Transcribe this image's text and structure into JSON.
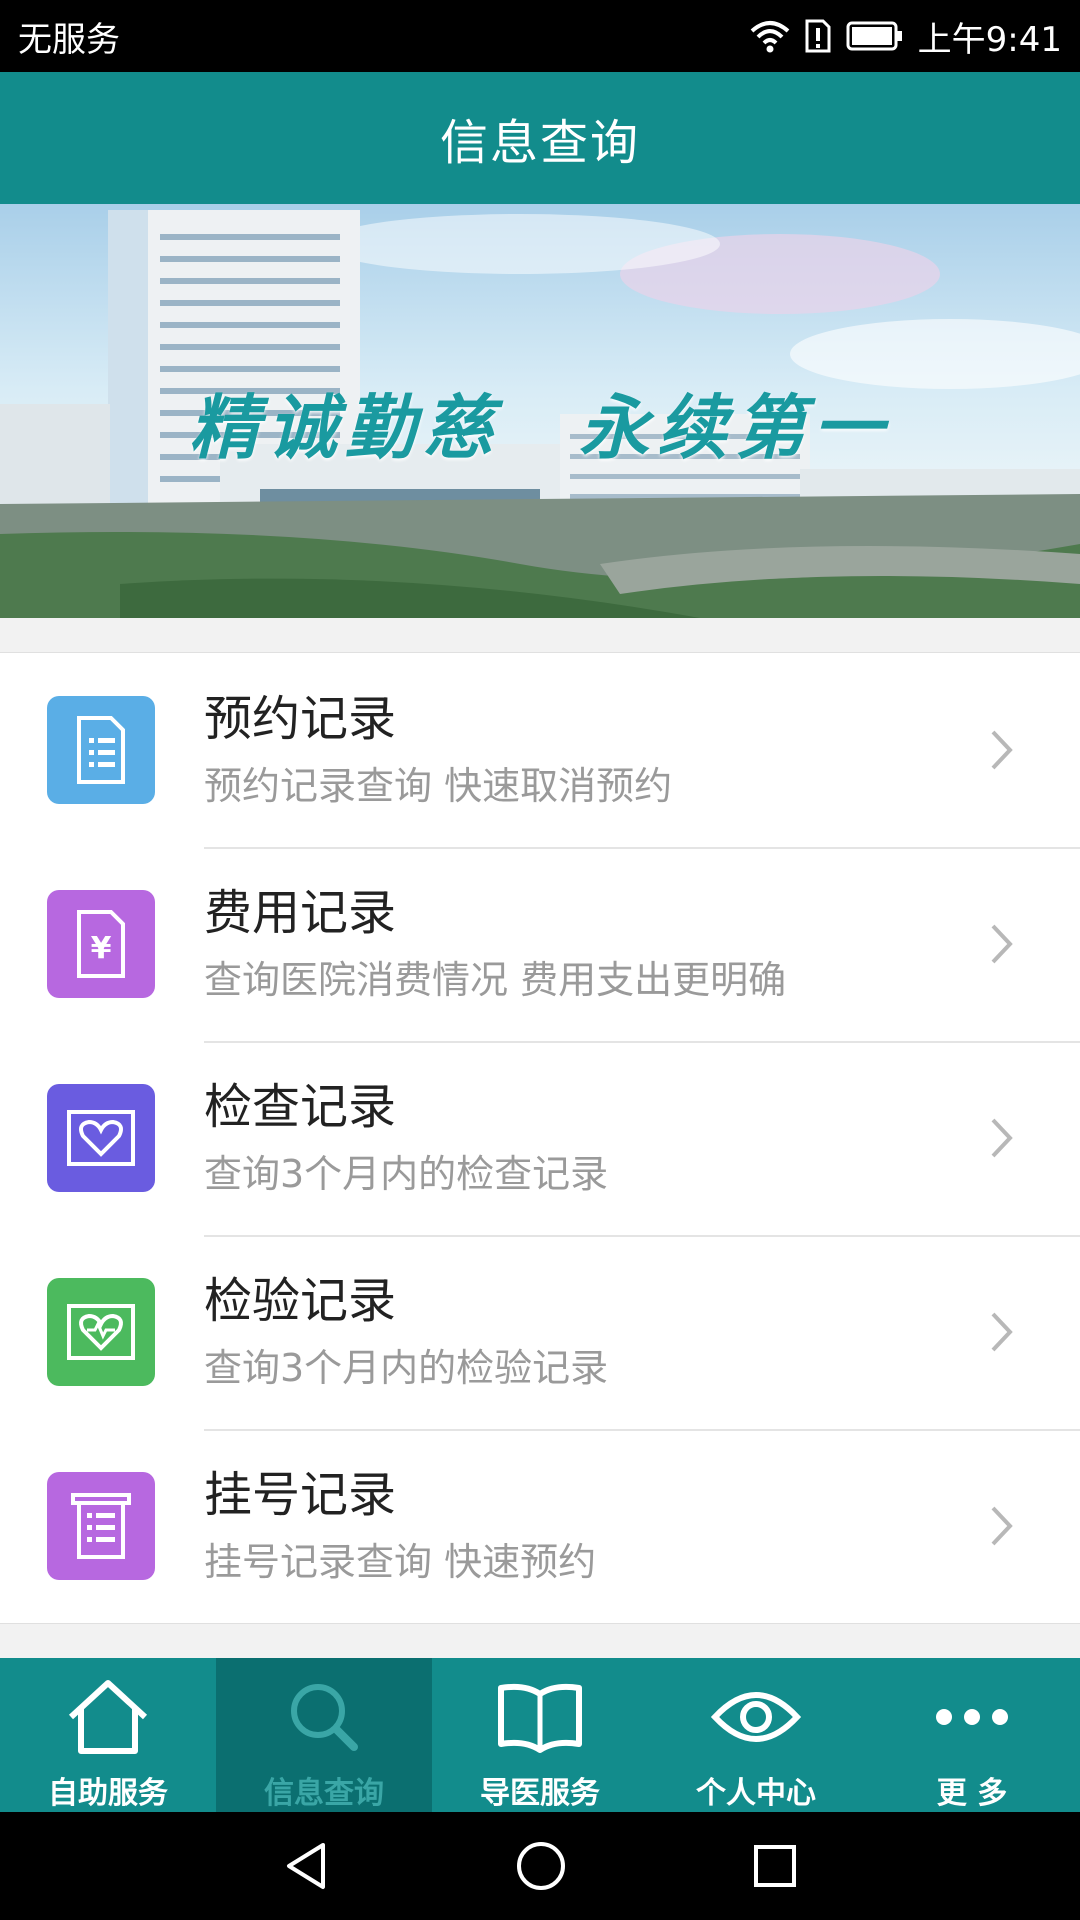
{
  "status_bar": {
    "carrier": "无服务",
    "time": "上午9:41"
  },
  "nav": {
    "title": "信息查询"
  },
  "banner": {
    "slogan": "精诚勤慈　永续第一"
  },
  "list": [
    {
      "title": "预约记录",
      "subtitle": "预约记录查询 快速取消预约",
      "icon": "document-list-icon",
      "color": "#5aaee6"
    },
    {
      "title": "费用记录",
      "subtitle": "查询医院消费情况 费用支出更明确",
      "icon": "yuan-invoice-icon",
      "color": "#b768e0"
    },
    {
      "title": "检查记录",
      "subtitle": "查询3个月内的检查记录",
      "icon": "heart-screen-icon",
      "color": "#6a5ce0"
    },
    {
      "title": "检验记录",
      "subtitle": "查询3个月内的检验记录",
      "icon": "heart-lab-icon",
      "color": "#4cba5e"
    },
    {
      "title": "挂号记录",
      "subtitle": "挂号记录查询 快速预约",
      "icon": "registration-list-icon",
      "color": "#b768e0"
    }
  ],
  "tabs": [
    {
      "label": "自助服务",
      "icon": "home-icon",
      "active": false
    },
    {
      "label": "信息查询",
      "icon": "search-icon",
      "active": true
    },
    {
      "label": "导医服务",
      "icon": "open-book-icon",
      "active": false
    },
    {
      "label": "个人中心",
      "icon": "eye-icon",
      "active": false
    },
    {
      "label": "更 多",
      "icon": "more-dots-icon",
      "active": false
    }
  ],
  "colors": {
    "header": "#128c8c",
    "tab_active": "#0b6f70"
  }
}
